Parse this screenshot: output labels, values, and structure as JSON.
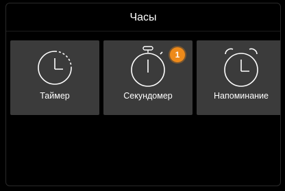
{
  "header": {
    "title": "Часы"
  },
  "tiles": [
    {
      "label": "Таймер",
      "icon": "timer-icon"
    },
    {
      "label": "Секундомер",
      "icon": "stopwatch-icon",
      "badge": "1"
    },
    {
      "label": "Напоминание",
      "icon": "alarm-clock-icon"
    }
  ],
  "colors": {
    "background": "#000000",
    "tile": "#3b3b3b",
    "badge": "#ee8a1a",
    "text": "#ffffff"
  }
}
